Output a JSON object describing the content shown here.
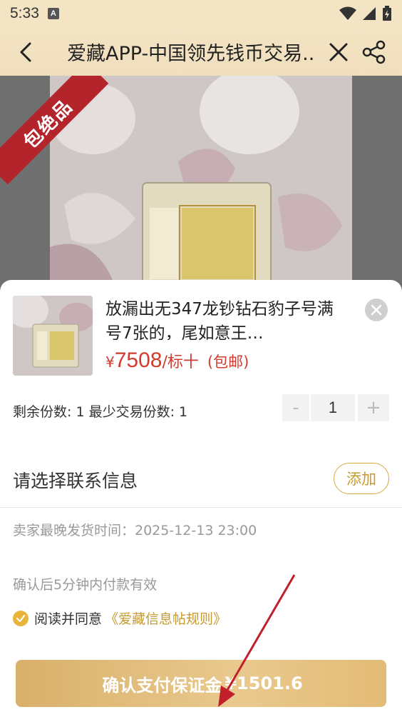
{
  "status_bar": {
    "time": "5:33",
    "notification_badge": "A"
  },
  "nav": {
    "title": "爱藏APP-中国领先钱币交易..",
    "icons": [
      "back-icon",
      "close-icon",
      "share-icon"
    ]
  },
  "photo": {
    "badge": "包绝品"
  },
  "product": {
    "title": "放漏出无347龙钞钻石豹子号满号7张的，尾如意王…",
    "price_symbol": "¥",
    "price_value": "7508",
    "price_unit": "/标十",
    "shipping": "(包邮)"
  },
  "quantity": {
    "remaining_label": "剩余份数: 1   最少交易份数: 1",
    "minus": "-",
    "value": "1",
    "plus": "+"
  },
  "contact": {
    "label": "请选择联系信息",
    "add_button": "添加",
    "ship_time": "卖家最晚发货时间：2025-12-13 23:00"
  },
  "confirm": {
    "note": "确认后5分钟内付款有效",
    "agree_text": "阅读并同意",
    "agree_link": "《爱藏信息帖规则》"
  },
  "pay_button": {
    "label": "确认支付保证金",
    "amount": "¥1501.6"
  },
  "colors": {
    "header_bg": "#f3e4c4",
    "price_red": "#d23b2e",
    "gold": "#c79a2e",
    "ribbon_red": "#b3252a"
  }
}
